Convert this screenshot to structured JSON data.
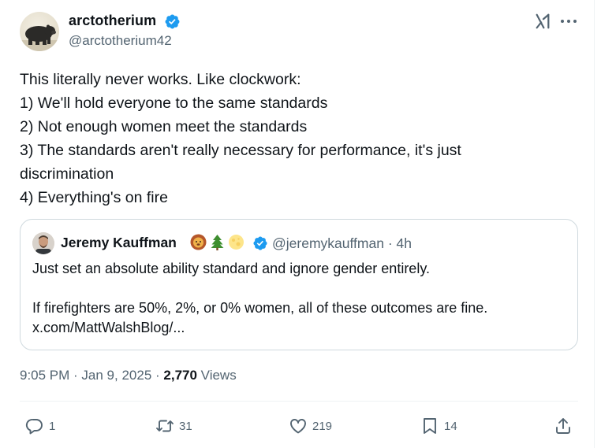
{
  "author": {
    "display_name": "arctotherium",
    "handle": "@arctotherium42",
    "verified": true
  },
  "tweet": {
    "lines": [
      "This literally never works. Like clockwork:",
      "1) We'll hold everyone to the same standards",
      "2) Not enough women meet the standards",
      "3) The standards aren't really necessary for performance, it's just",
      "discrimination",
      "4) Everything's on fire"
    ]
  },
  "quote": {
    "display_name": "Jeremy Kauffman",
    "emojis": [
      "lion-face-emoji",
      "evergreen-tree-emoji",
      "full-moon-emoji"
    ],
    "verified": true,
    "handle": "@jeremykauffman",
    "separator": "·",
    "time": "4h",
    "line1": "Just set an absolute ability standard and ignore gender entirely.",
    "line2": "If firefighters are 50%, 2%, or 0% women, all of these outcomes are fine.",
    "line3": "x.com/MattWalshBlog/..."
  },
  "meta": {
    "time": "9:05 PM",
    "sep1": " · ",
    "date": "Jan 9, 2025",
    "sep2": " · ",
    "views_count": "2,770",
    "views_label": " Views"
  },
  "actions": {
    "reply_count": "1",
    "retweet_count": "31",
    "like_count": "219",
    "bookmark_count": "14"
  },
  "colors": {
    "verified": "#1d9bf0",
    "secondary_text": "#536471",
    "primary_text": "#0f1419",
    "border": "#cfd9de"
  },
  "icons": [
    "grok-icon",
    "more-icon",
    "verified-badge-icon",
    "reply-icon",
    "retweet-icon",
    "like-icon",
    "bookmark-icon",
    "share-icon"
  ]
}
